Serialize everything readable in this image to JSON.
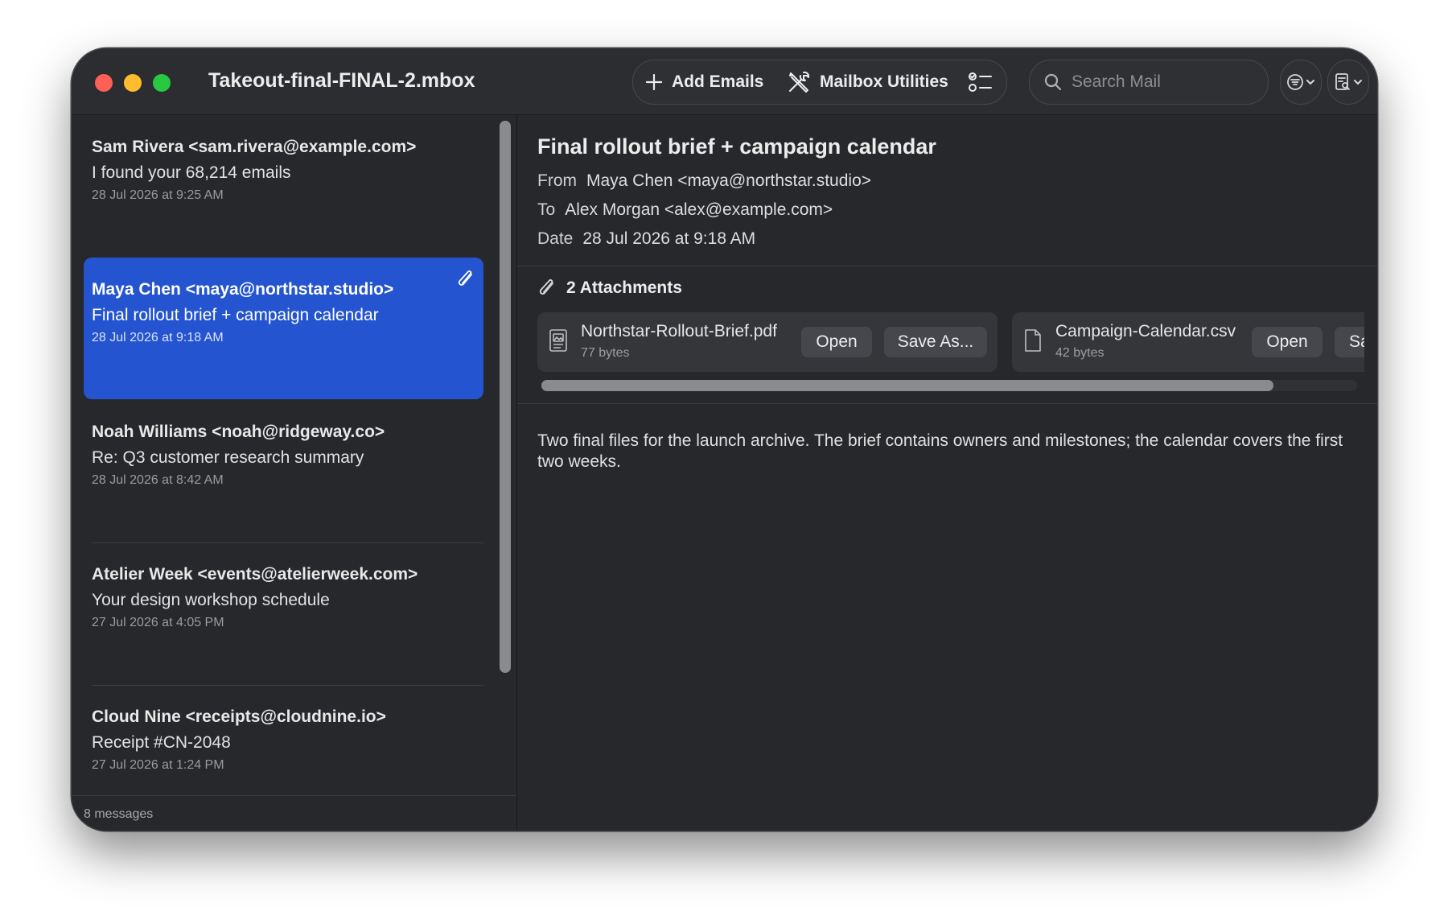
{
  "window": {
    "title": "Takeout-final-FINAL-2.mbox"
  },
  "toolbar": {
    "add_label": "Add Emails",
    "add_icon": "plus-icon",
    "utilities_label": "Mailbox Utilities",
    "utilities_icon": "tools-icon",
    "list_icon": "checklist-icon",
    "search_placeholder": "Search Mail",
    "filter_icon": "filter-icon",
    "view_icon": "view-options-icon"
  },
  "messages": [
    {
      "from": "Sam Rivera <sam.rivera@example.com>",
      "subject": "I found your 68,214 emails",
      "date": "28 Jul 2026 at 9:25 AM",
      "selected": false,
      "attachment": false
    },
    {
      "from": "Maya Chen <maya@northstar.studio>",
      "subject": "Final rollout brief + campaign calendar",
      "date": "28 Jul 2026 at 9:18 AM",
      "selected": true,
      "attachment": true
    },
    {
      "from": "Noah Williams <noah@ridgeway.co>",
      "subject": "Re: Q3 customer research summary",
      "date": "28 Jul 2026 at 8:42 AM",
      "selected": false,
      "attachment": false
    },
    {
      "from": "Atelier Week <events@atelierweek.com>",
      "subject": "Your design workshop schedule",
      "date": "27 Jul 2026 at 4:05 PM",
      "selected": false,
      "attachment": false
    },
    {
      "from": "Cloud Nine <receipts@cloudnine.io>",
      "subject": "Receipt #CN-2048",
      "date": "27 Jul 2026 at 1:24 PM",
      "selected": false,
      "attachment": false
    }
  ],
  "sidebar_footer": "8 messages",
  "reader": {
    "subject": "Final rollout brief + campaign calendar",
    "from_label": "From",
    "from_value": "Maya Chen <maya@northstar.studio>",
    "to_label": "To",
    "to_value": "Alex Morgan <alex@example.com>",
    "date_label": "Date",
    "date_value": "28 Jul 2026 at 9:18 AM",
    "attachments_title": "2 Attachments",
    "attachments": [
      {
        "name": "Northstar-Rollout-Brief.pdf",
        "size": "77 bytes",
        "open_label": "Open",
        "save_label": "Save As...",
        "icon": "pdf-file-icon"
      },
      {
        "name": "Campaign-Calendar.csv",
        "size": "42 bytes",
        "open_label": "Open",
        "save_label": "Save As...",
        "icon": "document-file-icon"
      }
    ],
    "body": "Two final files for the launch archive. The brief contains owners and milestones; the calendar covers the first two weeks."
  },
  "colors": {
    "selection": "#2454cf",
    "window_bg": "#26282b",
    "close": "#fe5f57",
    "minimize": "#febc2e",
    "zoom": "#28c840"
  }
}
